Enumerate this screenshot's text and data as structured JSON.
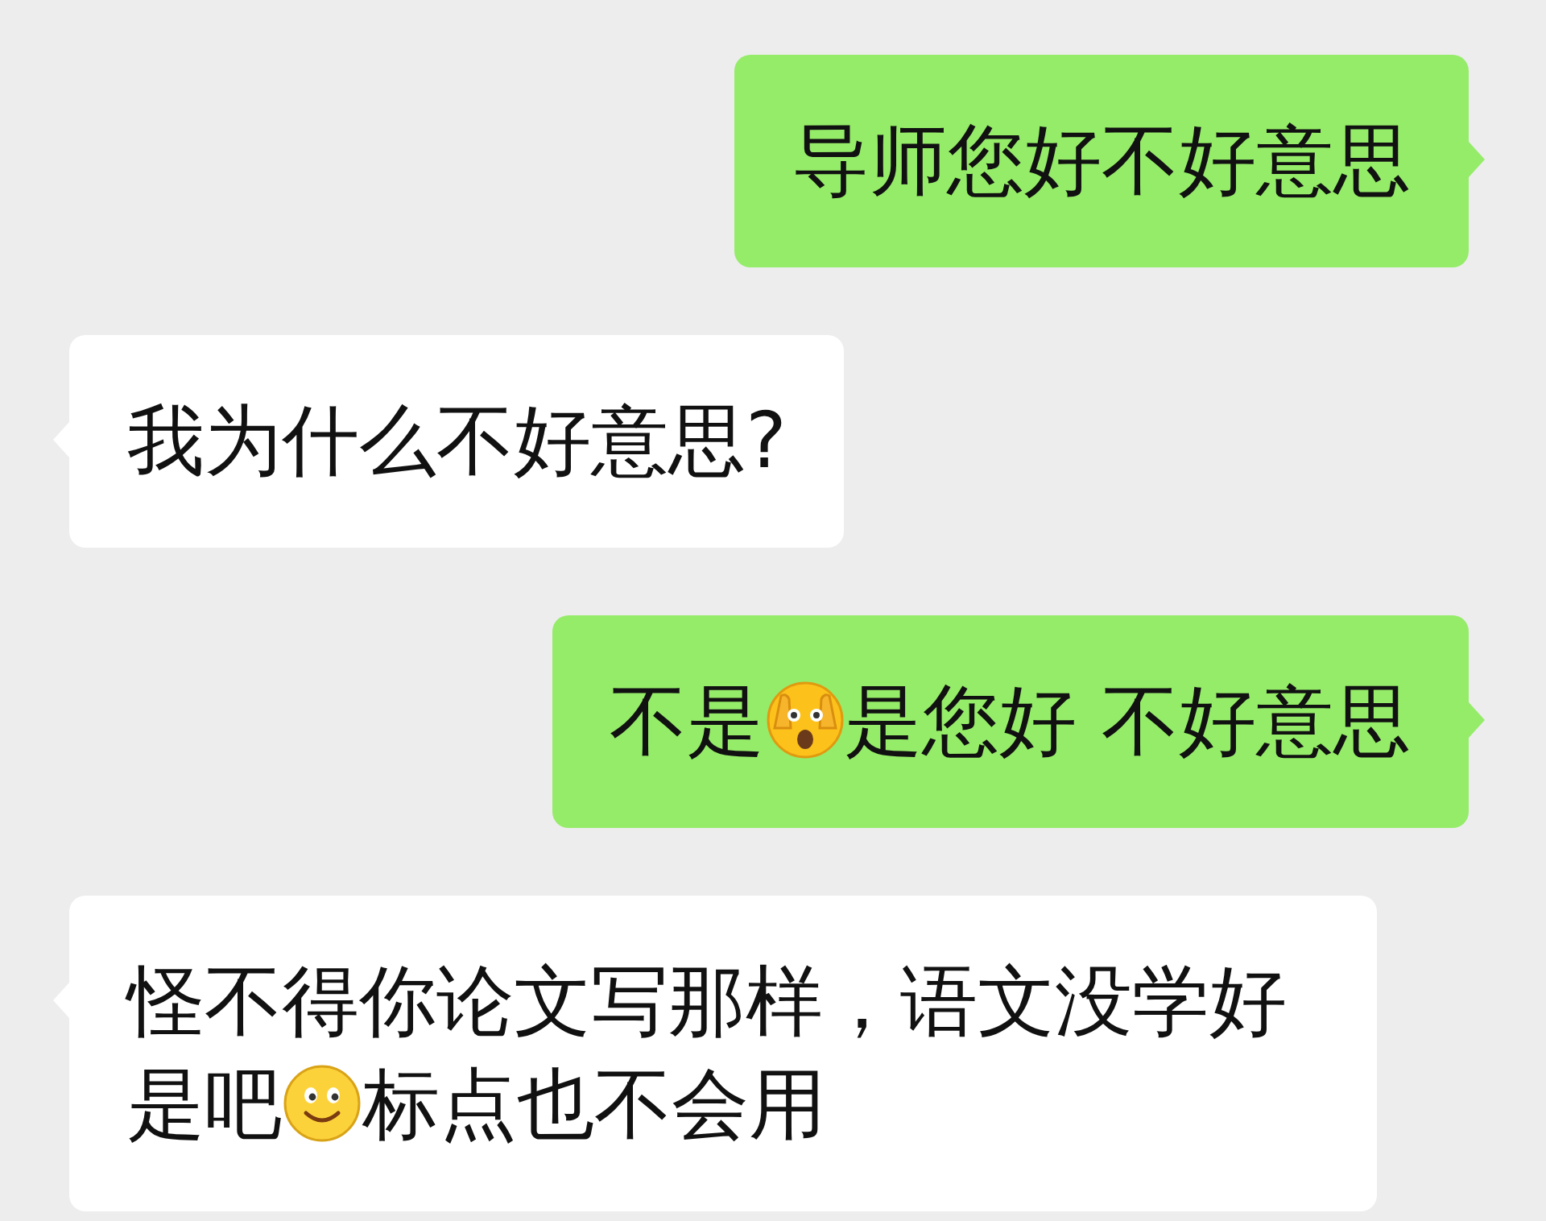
{
  "messages": [
    {
      "kind": "sent",
      "parts": [
        {
          "kind": "text",
          "text": "导师您好不好意思"
        }
      ]
    },
    {
      "kind": "received",
      "parts": [
        {
          "kind": "text",
          "text": "我为什么不好意思?"
        }
      ]
    },
    {
      "kind": "sent",
      "parts": [
        {
          "kind": "text",
          "text": "不是"
        },
        {
          "kind": "peek"
        },
        {
          "kind": "text",
          "text": "是您好 不好意思"
        }
      ]
    },
    {
      "kind": "received",
      "parts": [
        {
          "kind": "text",
          "text": "怪不得你论文写那样，语文没学好是吧"
        },
        {
          "kind": "smile"
        },
        {
          "kind": "text",
          "text": "标点也不会用"
        }
      ]
    }
  ]
}
